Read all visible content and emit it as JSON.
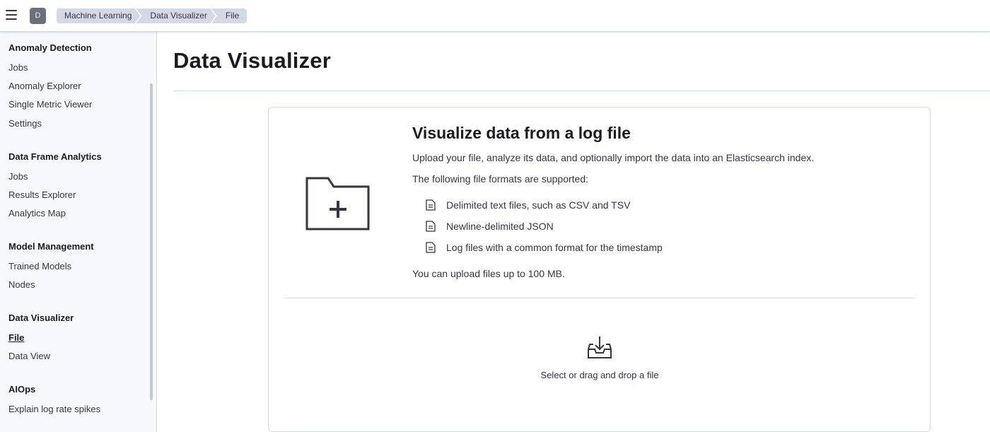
{
  "header": {
    "avatar_initial": "D",
    "breadcrumbs": [
      "Machine Learning",
      "Data Visualizer",
      "File"
    ]
  },
  "sidebar": {
    "groups": [
      {
        "title": "Anomaly Detection",
        "items": [
          "Jobs",
          "Anomaly Explorer",
          "Single Metric Viewer",
          "Settings"
        ]
      },
      {
        "title": "Data Frame Analytics",
        "items": [
          "Jobs",
          "Results Explorer",
          "Analytics Map"
        ]
      },
      {
        "title": "Model Management",
        "items": [
          "Trained Models",
          "Nodes"
        ]
      },
      {
        "title": "Data Visualizer",
        "items": [
          "File",
          "Data View"
        ]
      },
      {
        "title": "AIOps",
        "items": [
          "Explain log rate spikes"
        ]
      }
    ],
    "active_item": "File"
  },
  "main": {
    "page_title": "Data Visualizer",
    "about": {
      "title": "Visualize data from a log file",
      "description": "Upload your file, analyze its data, and optionally import the data into an Elasticsearch index.",
      "formats_intro": "The following file formats are supported:",
      "formats": [
        "Delimited text files, such as CSV and TSV",
        "Newline-delimited JSON",
        "Log files with a common format for the timestamp"
      ],
      "limit": "You can upload files up to 100 MB."
    },
    "drop_zone": {
      "label": "Select or drag and drop a file"
    }
  },
  "colors": {
    "text": "#1a1c21",
    "subdued": "#343741",
    "border": "#d3dae6",
    "sidebar_bg": "#f7f8fc"
  },
  "icons": [
    "menu-icon",
    "folder-plus-icon",
    "document-icon",
    "download-tray-icon"
  ]
}
